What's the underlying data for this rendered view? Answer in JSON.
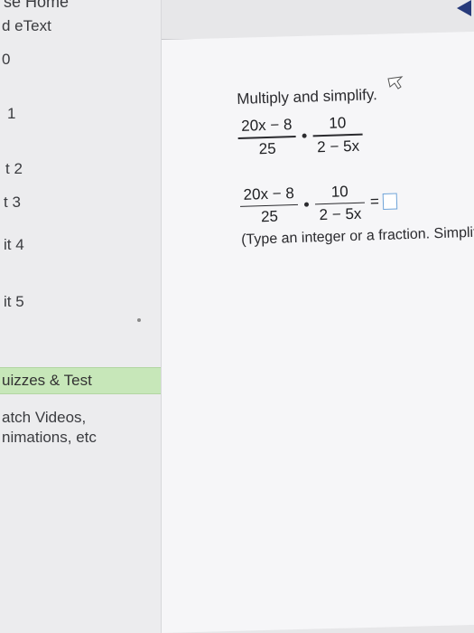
{
  "sidebar": {
    "course_home": "se Home",
    "etext": "d eText",
    "items": [
      "0",
      "1",
      "t 2",
      "t 3",
      "it 4",
      "it 5"
    ],
    "quizzes": "uizzes & Test",
    "watch": "atch Videos,",
    "animations": "nimations, etc"
  },
  "problem": {
    "instruction": "Multiply and simplify.",
    "expression": {
      "num1": "20x − 8",
      "den1": "25",
      "num2": "10",
      "den2": "2 − 5x"
    },
    "equals": "=",
    "answer_value": "",
    "hint": "(Type an integer or a fraction. Simplify your answer.)"
  },
  "colors": {
    "quiz_highlight": "#c7e7b9",
    "answer_border": "#6ea3d8",
    "nav_arrow": "#273a7a"
  }
}
